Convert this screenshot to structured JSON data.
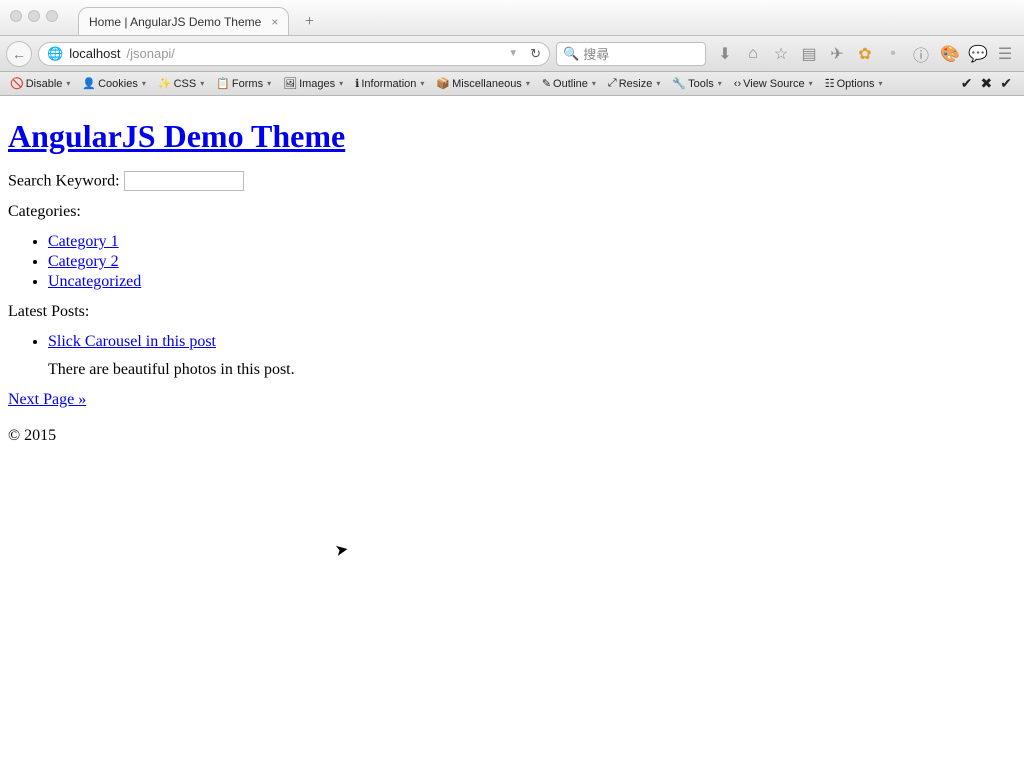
{
  "window": {
    "tab_title": "Home | AngularJS Demo Theme",
    "url_host": "localhost",
    "url_path": "/jsonapi/",
    "search_placeholder": "搜尋"
  },
  "devtools": {
    "items": [
      {
        "label": "Disable",
        "icon": "disable-icon"
      },
      {
        "label": "Cookies",
        "icon": "user-icon"
      },
      {
        "label": "CSS",
        "icon": "wand-icon"
      },
      {
        "label": "Forms",
        "icon": "clipboard-icon"
      },
      {
        "label": "Images",
        "icon": "image-icon"
      },
      {
        "label": "Information",
        "icon": "info-icon"
      },
      {
        "label": "Miscellaneous",
        "icon": "cube-icon"
      },
      {
        "label": "Outline",
        "icon": "pencil-icon"
      },
      {
        "label": "Resize",
        "icon": "resize-icon"
      },
      {
        "label": "Tools",
        "icon": "wrench-icon"
      },
      {
        "label": "View Source",
        "icon": "code-icon"
      },
      {
        "label": "Options",
        "icon": "sliders-icon"
      }
    ]
  },
  "page": {
    "title": "AngularJS Demo Theme",
    "search_label": "Search Keyword:",
    "categories_label": "Categories:",
    "categories": [
      {
        "label": "Category 1"
      },
      {
        "label": "Category 2"
      },
      {
        "label": "Uncategorized"
      }
    ],
    "latest_label": "Latest Posts:",
    "posts": [
      {
        "title": "Slick Carousel in this post",
        "excerpt": "There are beautiful photos in this post."
      }
    ],
    "next_label": "Next Page »",
    "footer": "© 2015"
  }
}
